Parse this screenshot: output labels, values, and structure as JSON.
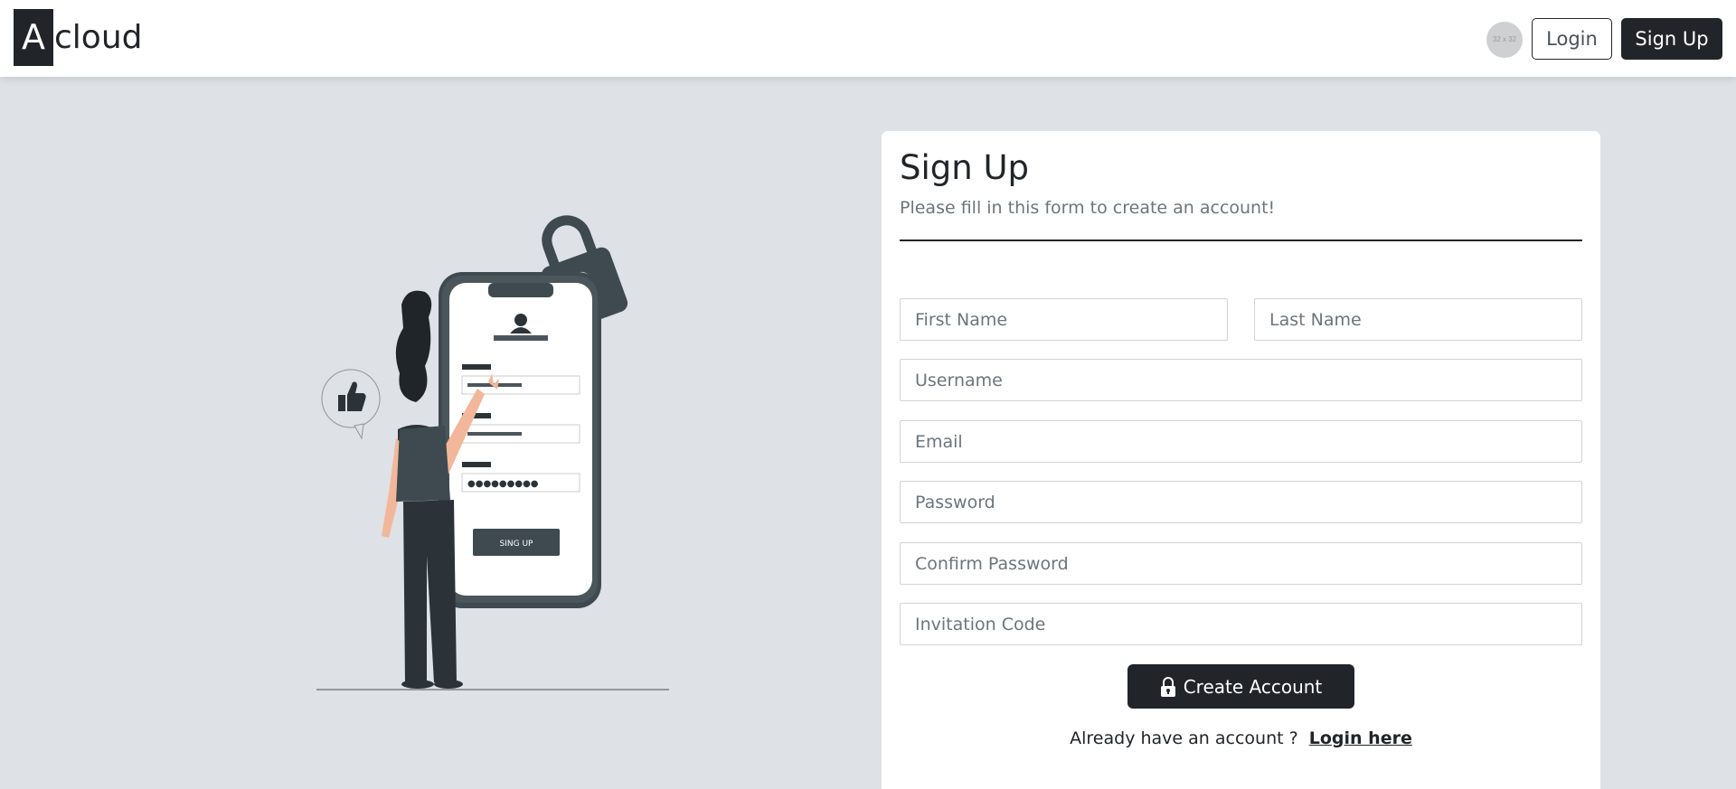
{
  "brand": {
    "logo_letter": "A",
    "logo_rest": "cloud"
  },
  "navbar": {
    "avatar_text": "32 x 32",
    "login_label": "Login",
    "signup_label": "Sign Up"
  },
  "illustration": {
    "button_label": "SING UP",
    "password_dots": "●●●●●●●●●"
  },
  "form": {
    "title": "Sign Up",
    "subtitle": "Please fill in this form to create an account!",
    "first_name_placeholder": "First Name",
    "last_name_placeholder": "Last Name",
    "username_placeholder": "Username",
    "email_placeholder": "Email",
    "password_placeholder": "Password",
    "confirm_password_placeholder": "Confirm Password",
    "invitation_code_placeholder": "Invitation Code",
    "submit_label": "Create Account",
    "already_text": "Already have an account ?",
    "login_link_label": "Login here"
  },
  "colors": {
    "page_background": "#dee1e5",
    "primary_dark": "#212529",
    "card_background": "#ffffff"
  },
  "icons": [
    "lock-icon",
    "thumbs-up-icon",
    "padlock-icon",
    "user-icon"
  ]
}
